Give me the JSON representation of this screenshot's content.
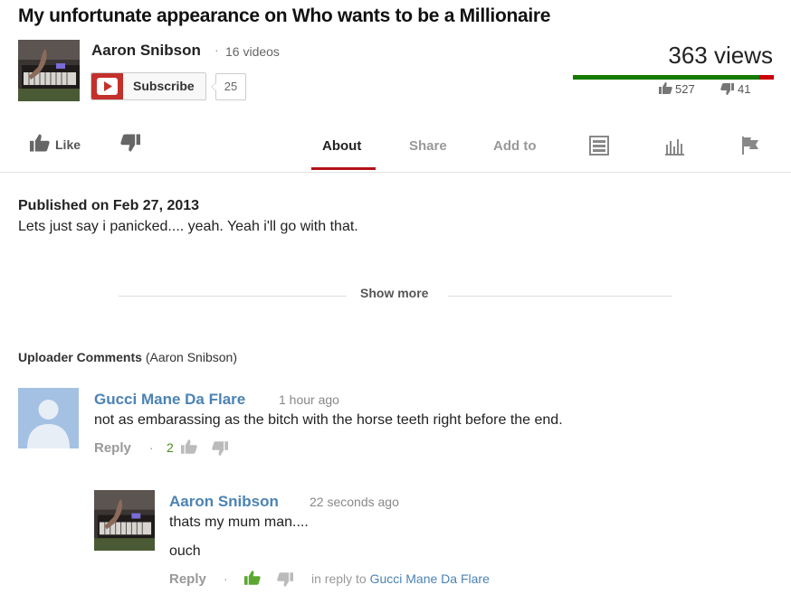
{
  "video": {
    "title": "My unfortunate appearance on Who wants to be a Millionaire",
    "views": "363 views",
    "likes": "527",
    "dislikes": "41",
    "like_ratio": 0.928
  },
  "channel": {
    "name": "Aaron Snibson",
    "separator": "·",
    "videos": "16 videos",
    "subscribe_label": "Subscribe",
    "subscriber_count": "25"
  },
  "actions": {
    "like_label": "Like",
    "tabs": [
      {
        "label": "About",
        "active": true
      },
      {
        "label": "Share",
        "active": false
      },
      {
        "label": "Add to",
        "active": false
      }
    ],
    "icons": [
      "transcript-icon",
      "stats-icon",
      "flag-icon"
    ]
  },
  "description": {
    "published": "Published on Feb 27, 2013",
    "text": "Lets just say i panicked.... yeah. Yeah i'll go with that.",
    "show_more": "Show more"
  },
  "comments_section": {
    "heading": "Uploader Comments",
    "heading_suffix": "(Aaron Snibson)",
    "comments": [
      {
        "author": "Gucci Mane Da Flare",
        "time": "1 hour ago",
        "text": "not as embarassing as the bitch with the horse teeth right before the end.",
        "reply_label": "Reply",
        "separator": "·",
        "likes": "2"
      },
      {
        "author": "Aaron Snibson",
        "time": "22 seconds ago",
        "text_lines": [
          "thats my mum man....",
          "ouch"
        ],
        "reply_label": "Reply",
        "separator": "·",
        "in_reply_prefix": "in reply to",
        "in_reply_to": "Gucci Mane Da Flare"
      }
    ]
  },
  "colors": {
    "like_green": "#167a00",
    "dislike_red": "#cc0000",
    "link_blue": "#4b83b5",
    "tab_accent": "#b31217",
    "subscribe_red": "#c4302b"
  }
}
